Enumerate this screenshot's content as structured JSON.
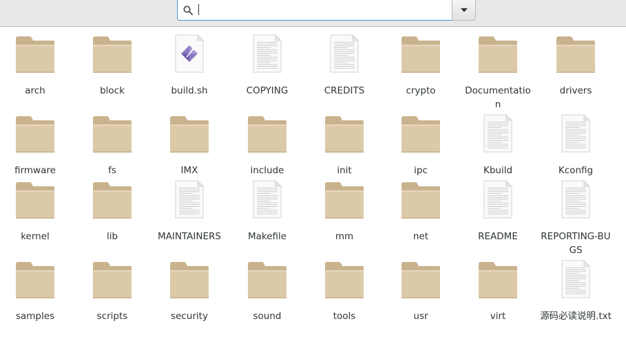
{
  "search": {
    "value": "",
    "placeholder": "",
    "dropdown_icon": "chevron-down-icon"
  },
  "colors": {
    "folder": "#dcc9a8",
    "folder_tab": "#c9b38e",
    "script_accent": "#8e7cc3",
    "toolbar_bg": "#e8e8e7",
    "focus_border": "#4a90d9"
  },
  "items": [
    {
      "label": "arch",
      "type": "folder"
    },
    {
      "label": "block",
      "type": "folder"
    },
    {
      "label": "build.sh",
      "type": "script"
    },
    {
      "label": "COPYING",
      "type": "text"
    },
    {
      "label": "CREDITS",
      "type": "text"
    },
    {
      "label": "crypto",
      "type": "folder"
    },
    {
      "label": "Documentation",
      "type": "folder"
    },
    {
      "label": "drivers",
      "type": "folder"
    },
    {
      "label": "firmware",
      "type": "folder"
    },
    {
      "label": "fs",
      "type": "folder"
    },
    {
      "label": "IMX",
      "type": "folder"
    },
    {
      "label": "include",
      "type": "folder"
    },
    {
      "label": "init",
      "type": "folder"
    },
    {
      "label": "ipc",
      "type": "folder"
    },
    {
      "label": "Kbuild",
      "type": "text"
    },
    {
      "label": "Kconfig",
      "type": "text"
    },
    {
      "label": "kernel",
      "type": "folder"
    },
    {
      "label": "lib",
      "type": "folder"
    },
    {
      "label": "MAINTAINERS",
      "type": "text"
    },
    {
      "label": "Makefile",
      "type": "text"
    },
    {
      "label": "mm",
      "type": "folder"
    },
    {
      "label": "net",
      "type": "folder"
    },
    {
      "label": "README",
      "type": "text"
    },
    {
      "label": "REPORTING-BUGS",
      "type": "text"
    },
    {
      "label": "samples",
      "type": "folder"
    },
    {
      "label": "scripts",
      "type": "folder"
    },
    {
      "label": "security",
      "type": "folder"
    },
    {
      "label": "sound",
      "type": "folder"
    },
    {
      "label": "tools",
      "type": "folder"
    },
    {
      "label": "usr",
      "type": "folder"
    },
    {
      "label": "virt",
      "type": "folder"
    },
    {
      "label": "源码必读说明.txt",
      "type": "text"
    }
  ]
}
